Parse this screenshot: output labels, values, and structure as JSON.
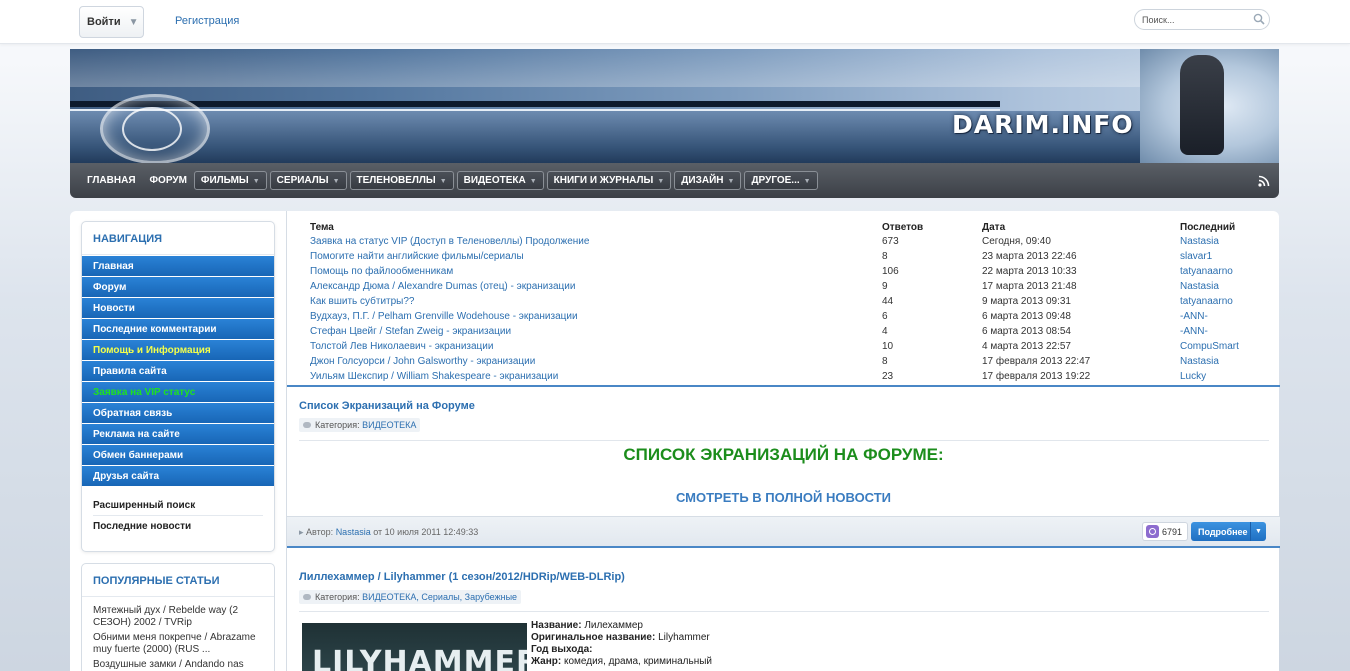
{
  "topbar": {
    "login_label": "Войти",
    "register_label": "Регистрация",
    "search_placeholder": "Поиск..."
  },
  "header": {
    "logo": "DARIM.INFO"
  },
  "nav": {
    "plain": [
      "ГЛАВНАЯ",
      "ФОРУМ"
    ],
    "dropdowns": [
      "ФИЛЬМЫ",
      "СЕРИАЛЫ",
      "ТЕЛЕНОВЕЛЛЫ",
      "ВИДЕОТЕКА",
      "КНИГИ И ЖУРНАЛЫ",
      "ДИЗАЙН",
      "ДРУГОЕ..."
    ]
  },
  "sidebar": {
    "nav_title": "НАВИГАЦИЯ",
    "menu": [
      "Главная",
      "Форум",
      "Новости",
      "Последние комментарии",
      "Помощь и Информация",
      "Правила сайта",
      "Заявка на VIP статус",
      "Обратная связь",
      "Реклама на сайте",
      "Обмен баннерами",
      "Друзья сайта"
    ],
    "extra": [
      "Расширенный поиск",
      "Последние новости"
    ],
    "popular_title": "ПОПУЛЯРНЫЕ СТАТЬИ",
    "popular": [
      "Мятежный дух / Rebelde way (2 СЕЗОН) 2002 / TVRip",
      "Обними меня покрепче / Abrazame muy fuerte (2000) (RUS ...",
      "Воздушные замки / Andando nas"
    ]
  },
  "topics": {
    "headers": [
      "Тема",
      "Ответов",
      "Дата",
      "Последний"
    ],
    "rows": [
      [
        "Заявка на статус VIP (Доступ в Теленовеллы) Продолжение",
        "673",
        "Сегодня, 09:40",
        "Nastasia"
      ],
      [
        "Помогите найти английские фильмы/сериалы",
        "8",
        "23 марта 2013 22:46",
        "slavar1"
      ],
      [
        "Помощь по файлообменникам",
        "106",
        "22 марта 2013 10:33",
        "tatyanaarno"
      ],
      [
        "Александр Дюма / Alexandre Dumas (отец) - экранизации",
        "9",
        "17 марта 2013 21:48",
        "Nastasia"
      ],
      [
        "Как вшить субтитры??",
        "44",
        "9 марта 2013 09:31",
        "tatyanaarno"
      ],
      [
        "Вудхауз, П.Г. / Pelham Grenville Wodehouse - экранизации",
        "6",
        "6 марта 2013 09:48",
        "-ANN-"
      ],
      [
        "Стефан Цвейг / Stefan Zweig - экранизации",
        "4",
        "6 марта 2013 08:54",
        "-ANN-"
      ],
      [
        "Толстой Лев Николаевич - экранизации",
        "10",
        "4 марта 2013 22:57",
        "CompuSmart"
      ],
      [
        "Джон Голсуорси / John Galsworthy - экранизации",
        "8",
        "17 февраля 2013 22:47",
        "Nastasia"
      ],
      [
        "Уильям Шекспир / William Shakespeare - экранизации",
        "23",
        "17 февраля 2013 19:22",
        "Lucky"
      ]
    ]
  },
  "news1": {
    "title": "Список Экранизаций на Форуме",
    "category_label": "Категория:",
    "category": "ВИДЕОТЕКА",
    "headline": "СПИСОК ЭКРАНИЗАЦИЙ НА ФОРУМЕ:",
    "more_link": "СМОТРЕТЬ В ПОЛНОЙ НОВОСТИ",
    "author_label": "Автор:",
    "author": "Nastasia",
    "date": "от 10 июля 2011 12:49:33",
    "views": "6791",
    "more_button": "Подробнее"
  },
  "news2": {
    "title": "Лиллехаммер / Lilyhammer (1 сезон/2012/HDRip/WEB-DLRip)",
    "category_label": "Категория:",
    "category": "ВИДЕОТЕКА, Сериалы, Зарубежные",
    "poster_text": "LILYHAMMER",
    "fields": [
      {
        "label": "Название:",
        "value": "Лилехаммер"
      },
      {
        "label": "Оригинальное название:",
        "value": "Lilyhammer"
      },
      {
        "label": "Год выхода:",
        "value": ""
      },
      {
        "label": "Жанр:",
        "value": "комедия, драма, криминальный"
      }
    ]
  }
}
